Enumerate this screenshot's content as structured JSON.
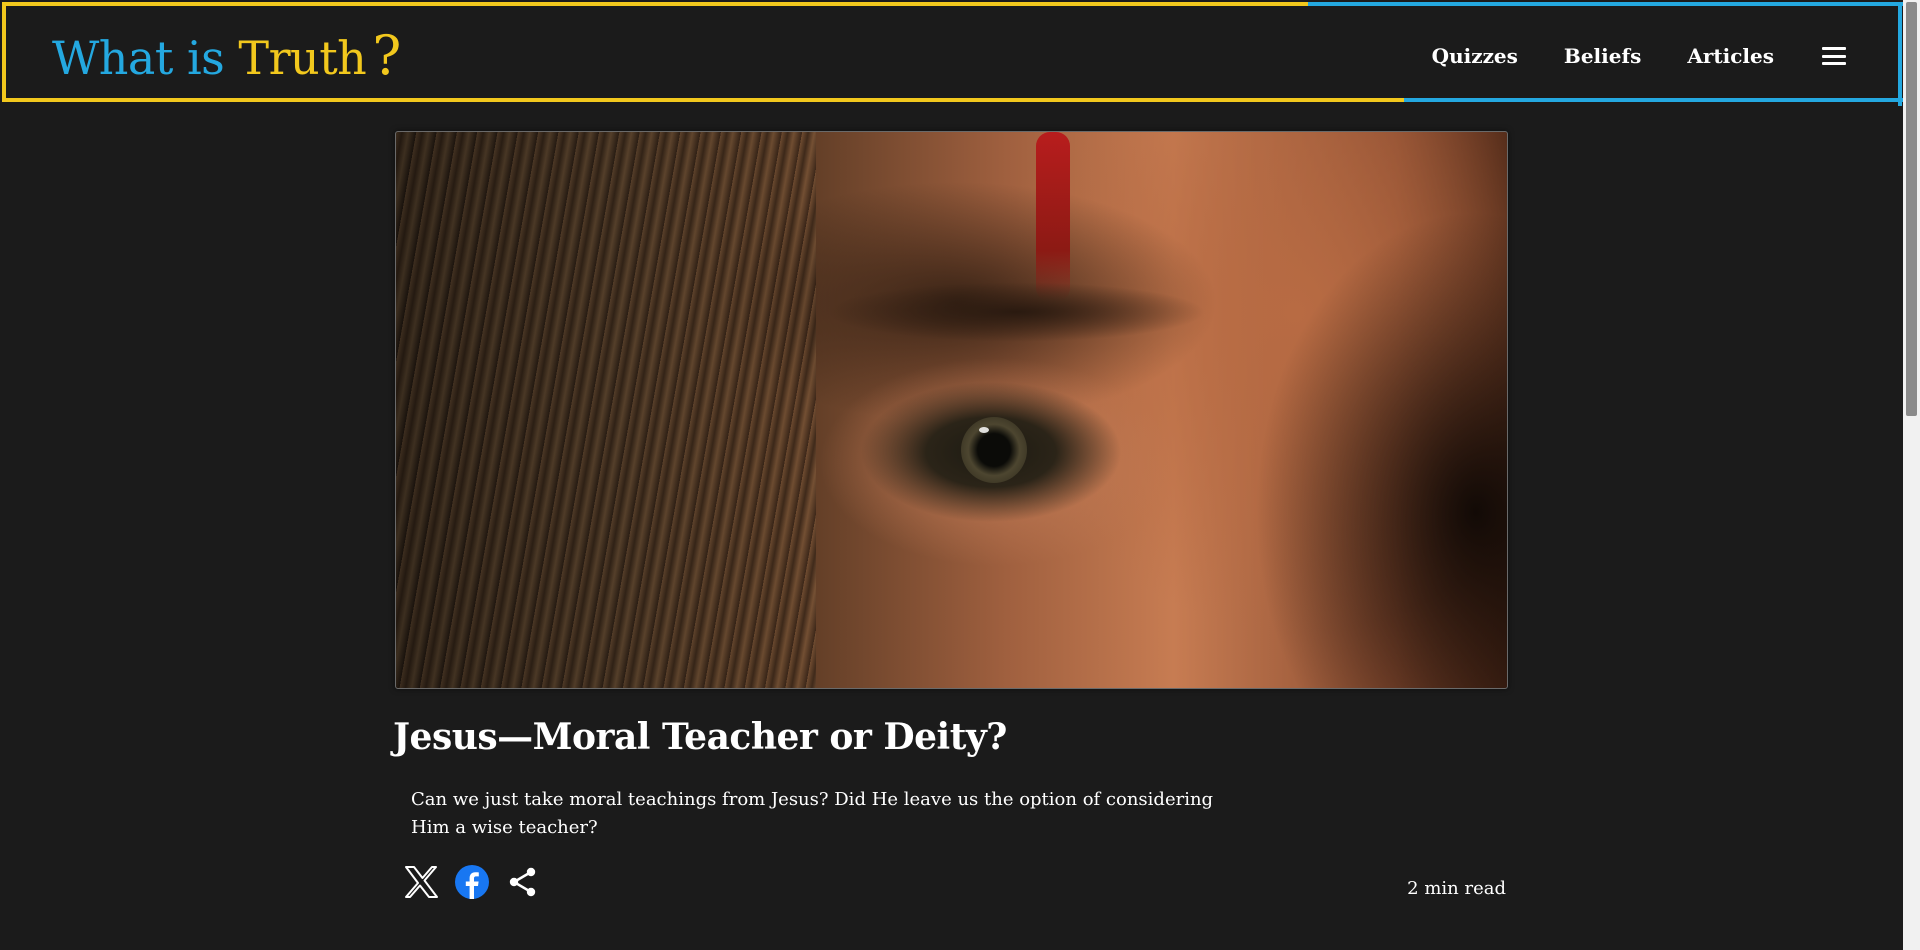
{
  "logo": {
    "word1": "What is",
    "word2": "Truth",
    "mark": "?"
  },
  "nav": {
    "items": [
      "Quizzes",
      "Beliefs",
      "Articles"
    ],
    "menu_icon": "hamburger-menu-icon"
  },
  "article": {
    "image_alt": "Close-up of a face with an eye, hair and blood",
    "title": "Jesus—Moral Teacher or Deity?",
    "description": "Can we just take moral teachings from Jesus? Did He leave us the option of considering Him a wise teacher?",
    "read_time": "2 min read"
  },
  "share": {
    "icons": [
      "x-icon",
      "facebook-icon",
      "share-icon"
    ]
  },
  "colors": {
    "background": "#1b1b1b",
    "brand_blue": "#24a8e0",
    "brand_yellow": "#f2c81d",
    "facebook_blue": "#1877f2",
    "text": "#ffffff"
  }
}
